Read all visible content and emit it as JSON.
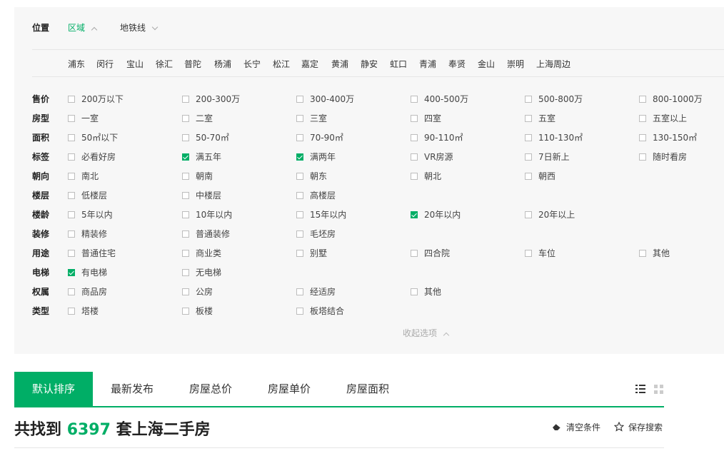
{
  "location": {
    "label": "位置",
    "tabs": [
      {
        "label": "区域",
        "active": true
      },
      {
        "label": "地铁线",
        "active": false
      }
    ],
    "districts": [
      "浦东",
      "闵行",
      "宝山",
      "徐汇",
      "普陀",
      "杨浦",
      "长宁",
      "松江",
      "嘉定",
      "黄浦",
      "静安",
      "虹口",
      "青浦",
      "奉贤",
      "金山",
      "崇明",
      "上海周边"
    ]
  },
  "filters": [
    {
      "label": "售价",
      "options": [
        {
          "text": "200万以下",
          "checked": false
        },
        {
          "text": "200-300万",
          "checked": false
        },
        {
          "text": "300-400万",
          "checked": false
        },
        {
          "text": "400-500万",
          "checked": false
        },
        {
          "text": "500-800万",
          "checked": false
        },
        {
          "text": "800-1000万",
          "checked": false
        }
      ]
    },
    {
      "label": "房型",
      "options": [
        {
          "text": "一室",
          "checked": false
        },
        {
          "text": "二室",
          "checked": false
        },
        {
          "text": "三室",
          "checked": false
        },
        {
          "text": "四室",
          "checked": false
        },
        {
          "text": "五室",
          "checked": false
        },
        {
          "text": "五室以上",
          "checked": false
        }
      ]
    },
    {
      "label": "面积",
      "options": [
        {
          "text": "50㎡以下",
          "checked": false
        },
        {
          "text": "50-70㎡",
          "checked": false
        },
        {
          "text": "70-90㎡",
          "checked": false
        },
        {
          "text": "90-110㎡",
          "checked": false
        },
        {
          "text": "110-130㎡",
          "checked": false
        },
        {
          "text": "130-150㎡",
          "checked": false
        }
      ]
    },
    {
      "label": "标签",
      "options": [
        {
          "text": "必看好房",
          "checked": false
        },
        {
          "text": "满五年",
          "checked": true
        },
        {
          "text": "满两年",
          "checked": true
        },
        {
          "text": "VR房源",
          "checked": false
        },
        {
          "text": "7日新上",
          "checked": false
        },
        {
          "text": "随时看房",
          "checked": false
        }
      ]
    },
    {
      "label": "朝向",
      "options": [
        {
          "text": "南北",
          "checked": false
        },
        {
          "text": "朝南",
          "checked": false
        },
        {
          "text": "朝东",
          "checked": false
        },
        {
          "text": "朝北",
          "checked": false
        },
        {
          "text": "朝西",
          "checked": false
        }
      ]
    },
    {
      "label": "楼层",
      "options": [
        {
          "text": "低楼层",
          "checked": false
        },
        {
          "text": "中楼层",
          "checked": false
        },
        {
          "text": "高楼层",
          "checked": false
        }
      ]
    },
    {
      "label": "楼龄",
      "options": [
        {
          "text": "5年以内",
          "checked": false
        },
        {
          "text": "10年以内",
          "checked": false
        },
        {
          "text": "15年以内",
          "checked": false
        },
        {
          "text": "20年以内",
          "checked": true
        },
        {
          "text": "20年以上",
          "checked": false
        }
      ]
    },
    {
      "label": "装修",
      "options": [
        {
          "text": "精装修",
          "checked": false
        },
        {
          "text": "普通装修",
          "checked": false
        },
        {
          "text": "毛坯房",
          "checked": false
        }
      ]
    },
    {
      "label": "用途",
      "options": [
        {
          "text": "普通住宅",
          "checked": false
        },
        {
          "text": "商业类",
          "checked": false
        },
        {
          "text": "别墅",
          "checked": false
        },
        {
          "text": "四合院",
          "checked": false
        },
        {
          "text": "车位",
          "checked": false
        },
        {
          "text": "其他",
          "checked": false
        }
      ]
    },
    {
      "label": "电梯",
      "options": [
        {
          "text": "有电梯",
          "checked": true
        },
        {
          "text": "无电梯",
          "checked": false
        }
      ]
    },
    {
      "label": "权属",
      "options": [
        {
          "text": "商品房",
          "checked": false
        },
        {
          "text": "公房",
          "checked": false
        },
        {
          "text": "经适房",
          "checked": false
        },
        {
          "text": "其他",
          "checked": false
        }
      ]
    },
    {
      "label": "类型",
      "options": [
        {
          "text": "塔楼",
          "checked": false
        },
        {
          "text": "板楼",
          "checked": false
        },
        {
          "text": "板塔结合",
          "checked": false
        }
      ]
    }
  ],
  "collapse_label": "收起选项",
  "sort": {
    "tabs": [
      "默认排序",
      "最新发布",
      "房屋总价",
      "房屋单价",
      "房屋面积"
    ],
    "active_index": 0
  },
  "result": {
    "prefix": "共找到",
    "count": "6397",
    "suffix": "套上海二手房"
  },
  "actions": {
    "clear_label": "清空条件",
    "save_label": "保存搜索"
  },
  "colors": {
    "accent": "#00ae66"
  }
}
